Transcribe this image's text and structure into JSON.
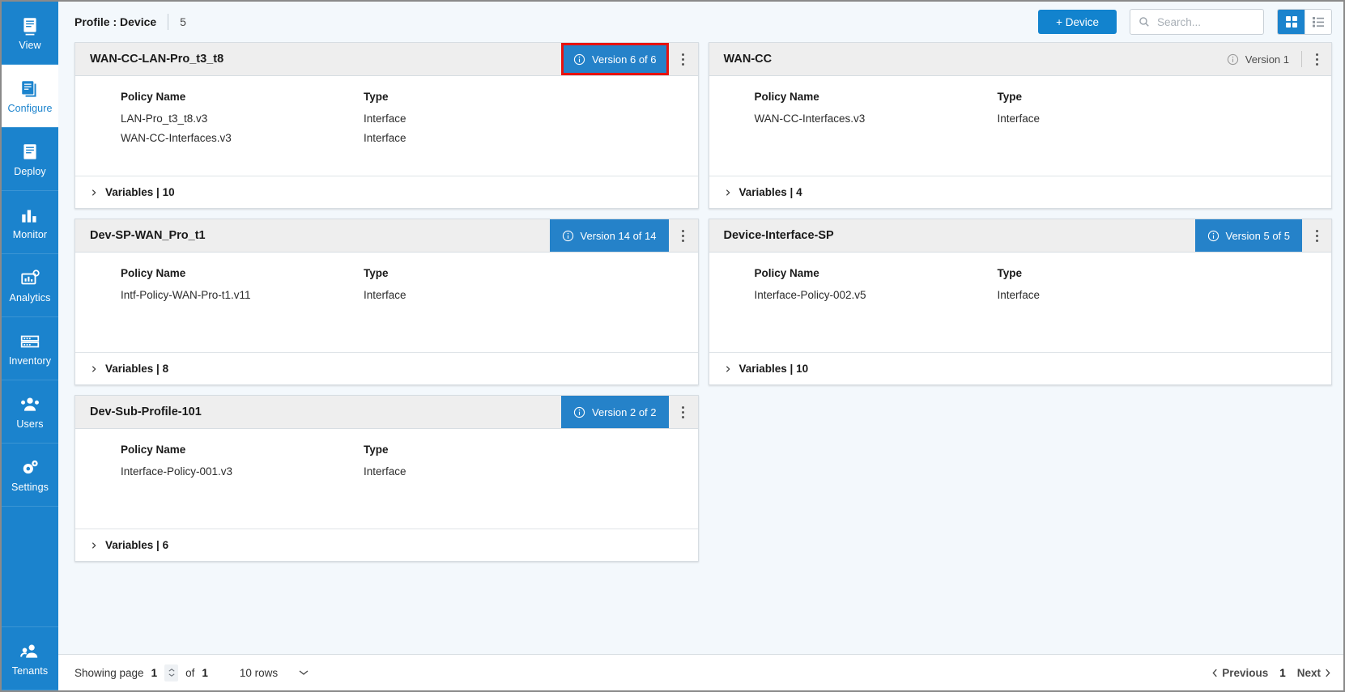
{
  "sidebar": {
    "items": [
      {
        "label": "View",
        "icon": "document-icon",
        "active": false
      },
      {
        "label": "Configure",
        "icon": "documents-icon",
        "active": true
      },
      {
        "label": "Deploy",
        "icon": "document-icon",
        "active": false
      },
      {
        "label": "Monitor",
        "icon": "bar-chart-icon",
        "active": false
      },
      {
        "label": "Analytics",
        "icon": "analytics-icon",
        "active": false
      },
      {
        "label": "Inventory",
        "icon": "inventory-icon",
        "active": false
      },
      {
        "label": "Users",
        "icon": "users-icon",
        "active": false
      },
      {
        "label": "Settings",
        "icon": "gears-icon",
        "active": false
      },
      {
        "label": "Tenants",
        "icon": "tenants-icon",
        "active": false
      }
    ]
  },
  "header": {
    "breadcrumb": "Profile : Device",
    "count": "5",
    "add_button": "+ Device",
    "search": {
      "value": "",
      "placeholder": "Search..."
    },
    "view_grid": "grid-view-icon",
    "view_list": "list-view-icon",
    "active_view": "grid"
  },
  "table_headers": {
    "policy_name": "Policy Name",
    "type": "Type"
  },
  "cards": [
    {
      "title": "WAN-CC-LAN-Pro_t3_t8",
      "version": "Version 6 of 6",
      "version_style": "solid",
      "highlighted": true,
      "policies": [
        {
          "name": "LAN-Pro_t3_t8.v3",
          "type": "Interface"
        },
        {
          "name": "WAN-CC-Interfaces.v3",
          "type": "Interface"
        }
      ],
      "variables": "Variables | 10"
    },
    {
      "title": "WAN-CC",
      "version": "Version 1",
      "version_style": "plain",
      "highlighted": false,
      "policies": [
        {
          "name": "WAN-CC-Interfaces.v3",
          "type": "Interface"
        }
      ],
      "variables": "Variables | 4"
    },
    {
      "title": "Dev-SP-WAN_Pro_t1",
      "version": "Version 14 of 14",
      "version_style": "solid",
      "highlighted": false,
      "policies": [
        {
          "name": "Intf-Policy-WAN-Pro-t1.v11",
          "type": "Interface"
        }
      ],
      "variables": "Variables | 8"
    },
    {
      "title": "Device-Interface-SP",
      "version": "Version 5 of 5",
      "version_style": "solid",
      "highlighted": false,
      "policies": [
        {
          "name": "Interface-Policy-002.v5",
          "type": "Interface"
        }
      ],
      "variables": "Variables | 10"
    },
    {
      "title": "Dev-Sub-Profile-101",
      "version": "Version 2 of 2",
      "version_style": "solid",
      "highlighted": false,
      "policies": [
        {
          "name": "Interface-Policy-001.v3",
          "type": "Interface"
        }
      ],
      "variables": "Variables | 6"
    }
  ],
  "pagination": {
    "showing_label": "Showing page",
    "current_page": "1",
    "of_label": "of",
    "total_pages": "1",
    "rows_per_page": "10 rows",
    "previous": "Previous",
    "page_number": "1",
    "next": "Next"
  },
  "colors": {
    "sidebar_blue": "#1b83cd",
    "badge_blue": "#2582c9",
    "button_blue": "#1283ce",
    "highlight_red": "#e8120e",
    "page_bg": "#f3f8fc"
  }
}
